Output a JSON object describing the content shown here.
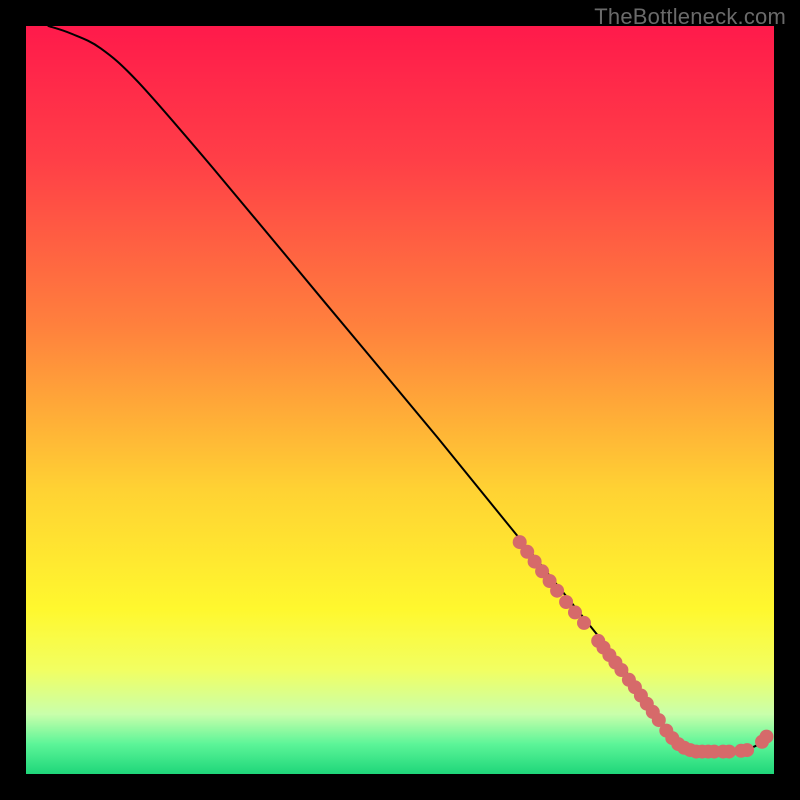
{
  "watermark": "TheBottleneck.com",
  "chart_data": {
    "type": "line",
    "title": "",
    "xlabel": "",
    "ylabel": "",
    "xlim": [
      0,
      100
    ],
    "ylim": [
      0,
      100
    ],
    "gradient_stops": [
      {
        "offset": 0,
        "color": "#ff1a4b"
      },
      {
        "offset": 18,
        "color": "#ff3f47"
      },
      {
        "offset": 40,
        "color": "#ff803d"
      },
      {
        "offset": 62,
        "color": "#ffd233"
      },
      {
        "offset": 78,
        "color": "#fff82e"
      },
      {
        "offset": 86,
        "color": "#f2ff61"
      },
      {
        "offset": 92,
        "color": "#c9ffab"
      },
      {
        "offset": 96,
        "color": "#5cf598"
      },
      {
        "offset": 100,
        "color": "#1fd67a"
      }
    ],
    "series": [
      {
        "name": "curve",
        "color": "#000000",
        "points": [
          {
            "x": 3,
            "y": 100
          },
          {
            "x": 6,
            "y": 99
          },
          {
            "x": 10,
            "y": 97
          },
          {
            "x": 15,
            "y": 92.5
          },
          {
            "x": 25,
            "y": 81
          },
          {
            "x": 40,
            "y": 63
          },
          {
            "x": 55,
            "y": 45
          },
          {
            "x": 68,
            "y": 29
          },
          {
            "x": 80,
            "y": 14
          },
          {
            "x": 84,
            "y": 8
          },
          {
            "x": 86,
            "y": 5
          },
          {
            "x": 88,
            "y": 3.5
          },
          {
            "x": 90,
            "y": 3
          },
          {
            "x": 94,
            "y": 3
          },
          {
            "x": 96,
            "y": 3.2
          },
          {
            "x": 98,
            "y": 4
          },
          {
            "x": 99,
            "y": 5
          }
        ]
      }
    ],
    "markers": {
      "name": "overlay-dots",
      "color": "#d66a6a",
      "radius_px": 7,
      "points": [
        {
          "x": 66,
          "y": 31
        },
        {
          "x": 67,
          "y": 29.7
        },
        {
          "x": 68,
          "y": 28.4
        },
        {
          "x": 69,
          "y": 27.1
        },
        {
          "x": 70,
          "y": 25.8
        },
        {
          "x": 71,
          "y": 24.5
        },
        {
          "x": 72.2,
          "y": 23
        },
        {
          "x": 73.4,
          "y": 21.6
        },
        {
          "x": 74.6,
          "y": 20.2
        },
        {
          "x": 76.5,
          "y": 17.8
        },
        {
          "x": 77.2,
          "y": 16.9
        },
        {
          "x": 78,
          "y": 15.9
        },
        {
          "x": 78.8,
          "y": 14.9
        },
        {
          "x": 79.6,
          "y": 13.9
        },
        {
          "x": 80.6,
          "y": 12.6
        },
        {
          "x": 81.4,
          "y": 11.6
        },
        {
          "x": 82.2,
          "y": 10.5
        },
        {
          "x": 83,
          "y": 9.4
        },
        {
          "x": 83.8,
          "y": 8.3
        },
        {
          "x": 84.6,
          "y": 7.2
        },
        {
          "x": 85.6,
          "y": 5.8
        },
        {
          "x": 86.4,
          "y": 4.8
        },
        {
          "x": 87.2,
          "y": 4
        },
        {
          "x": 88,
          "y": 3.5
        },
        {
          "x": 88.8,
          "y": 3.2
        },
        {
          "x": 89.6,
          "y": 3
        },
        {
          "x": 90.4,
          "y": 3
        },
        {
          "x": 91.2,
          "y": 3
        },
        {
          "x": 92,
          "y": 3
        },
        {
          "x": 93.2,
          "y": 3
        },
        {
          "x": 94,
          "y": 3
        },
        {
          "x": 95.6,
          "y": 3.1
        },
        {
          "x": 96.4,
          "y": 3.2
        },
        {
          "x": 98.4,
          "y": 4.3
        },
        {
          "x": 99,
          "y": 5
        }
      ]
    }
  }
}
